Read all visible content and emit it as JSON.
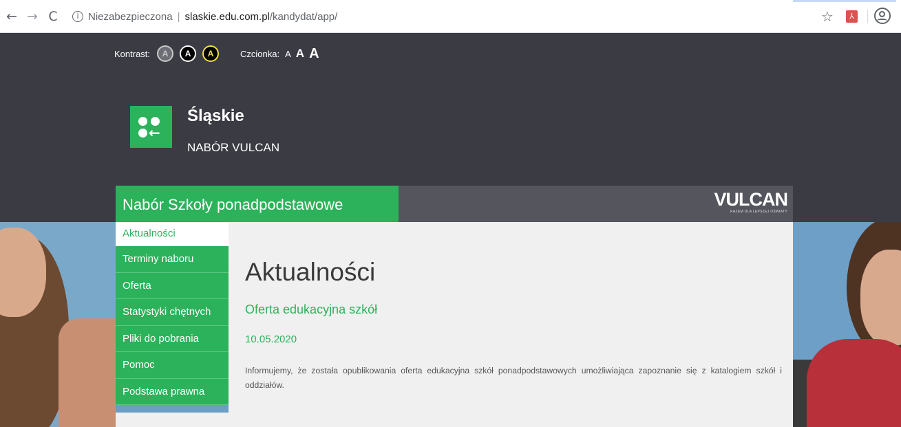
{
  "browser": {
    "back_icon": "←",
    "forward_icon": "→",
    "reload_icon": "C",
    "info_icon": "i",
    "security_label": "Niezabezpieczona",
    "separator": "|",
    "url_host": "slaskie.edu.com.pl",
    "url_path": "/kandydat/app/",
    "star_icon": "☆",
    "pdf_icon": "⅄"
  },
  "accessibility": {
    "contrast_label": "Kontrast:",
    "contrast_options": [
      "A",
      "A",
      "A"
    ],
    "font_label": "Czcionka:",
    "font_sizes": [
      "A",
      "A",
      "A"
    ]
  },
  "brand": {
    "arrow_glyph": "←",
    "title": "Śląskie",
    "subtitle": "NABÓR VULCAN"
  },
  "banner": {
    "title": "Nabór Szkoły ponadpodstawowe",
    "vulcan_word": "VULCAN",
    "vulcan_tagline": "RAZEM DLA LEPSZEJ OŚWIATY"
  },
  "sidebar": {
    "items": [
      {
        "label": "Aktualności"
      },
      {
        "label": "Terminy naboru"
      },
      {
        "label": "Oferta"
      },
      {
        "label": "Statystyki chętnych"
      },
      {
        "label": "Pliki do pobrania"
      },
      {
        "label": "Pomoc"
      },
      {
        "label": "Podstawa prawna"
      }
    ]
  },
  "main": {
    "heading": "Aktualności",
    "news": {
      "title": "Oferta edukacyjna szkół",
      "date": "10.05.2020",
      "body": "Informujemy, że została opublikowania oferta edukacyjna szkół ponadpodstawowych umożliwiająca zapoznanie się z katalogiem szkół i oddziałów."
    }
  },
  "colors": {
    "brand_green": "#2cb25a",
    "header_dark": "#3b3b44",
    "banner_gray": "#55555e",
    "content_bg": "#f0f0f0",
    "contrast_yellow": "#f3e23a"
  }
}
